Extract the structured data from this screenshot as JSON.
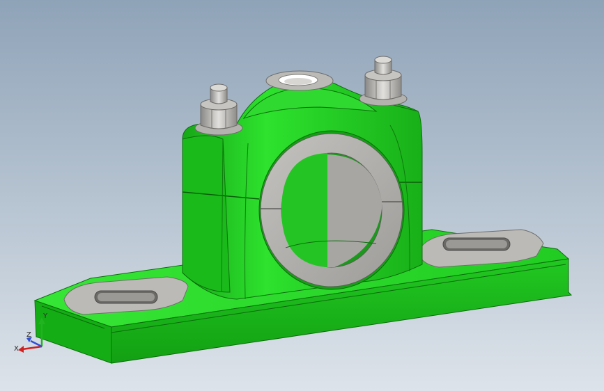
{
  "viewport": {
    "background_top": "#8fa3b8",
    "background_bottom": "#dde3ea"
  },
  "model": {
    "part": "pillow-block-bearing-housing",
    "housing_color": "#1fc21f",
    "housing_dark": "#0e8a10",
    "bushing_color": "#b7b5b2",
    "bolt_color": "#c9c7c4"
  },
  "triad": {
    "x_label": "X",
    "y_label": "Y",
    "z_label": "Z",
    "x_color": "#d21f1f",
    "y_color": "#21b421",
    "z_color": "#2f4fd8"
  }
}
